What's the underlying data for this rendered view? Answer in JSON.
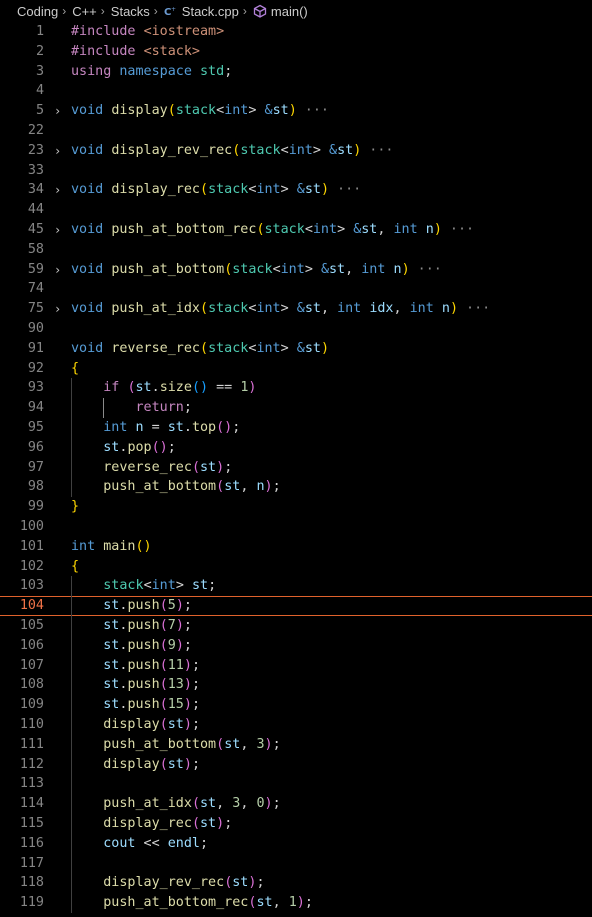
{
  "breadcrumb": {
    "items": [
      "Coding",
      "C++",
      "Stacks",
      "Stack.cpp",
      "main()"
    ]
  },
  "editor": {
    "current_line": "104",
    "lines": [
      {
        "n": "1",
        "fold": false,
        "tokens": [
          [
            "pp",
            "#include "
          ],
          [
            "str",
            "<iostream>"
          ]
        ]
      },
      {
        "n": "2",
        "fold": false,
        "tokens": [
          [
            "pp",
            "#include "
          ],
          [
            "str",
            "<stack>"
          ]
        ]
      },
      {
        "n": "3",
        "fold": false,
        "tokens": [
          [
            "ctl",
            "using "
          ],
          [
            "kw",
            "namespace "
          ],
          [
            "ty",
            "std"
          ],
          [
            "op",
            ";"
          ]
        ]
      },
      {
        "n": "4",
        "fold": false,
        "tokens": []
      },
      {
        "n": "5",
        "fold": true,
        "tokens": [
          [
            "kw",
            "void "
          ],
          [
            "fn",
            "display"
          ],
          [
            "b1",
            "("
          ],
          [
            "ty",
            "stack"
          ],
          [
            "op",
            "<"
          ],
          [
            "kw",
            "int"
          ],
          [
            "op",
            "> "
          ],
          [
            "kw",
            "&"
          ],
          [
            "var",
            "st"
          ],
          [
            "b1",
            ")"
          ],
          [
            "ell",
            " ···"
          ]
        ]
      },
      {
        "n": "22",
        "fold": false,
        "tokens": []
      },
      {
        "n": "23",
        "fold": true,
        "tokens": [
          [
            "kw",
            "void "
          ],
          [
            "fn",
            "display_rev_rec"
          ],
          [
            "b1",
            "("
          ],
          [
            "ty",
            "stack"
          ],
          [
            "op",
            "<"
          ],
          [
            "kw",
            "int"
          ],
          [
            "op",
            "> "
          ],
          [
            "kw",
            "&"
          ],
          [
            "var",
            "st"
          ],
          [
            "b1",
            ")"
          ],
          [
            "ell",
            " ···"
          ]
        ]
      },
      {
        "n": "33",
        "fold": false,
        "tokens": []
      },
      {
        "n": "34",
        "fold": true,
        "tokens": [
          [
            "kw",
            "void "
          ],
          [
            "fn",
            "display_rec"
          ],
          [
            "b1",
            "("
          ],
          [
            "ty",
            "stack"
          ],
          [
            "op",
            "<"
          ],
          [
            "kw",
            "int"
          ],
          [
            "op",
            "> "
          ],
          [
            "kw",
            "&"
          ],
          [
            "var",
            "st"
          ],
          [
            "b1",
            ")"
          ],
          [
            "ell",
            " ···"
          ]
        ]
      },
      {
        "n": "44",
        "fold": false,
        "tokens": []
      },
      {
        "n": "45",
        "fold": true,
        "tokens": [
          [
            "kw",
            "void "
          ],
          [
            "fn",
            "push_at_bottom_rec"
          ],
          [
            "b1",
            "("
          ],
          [
            "ty",
            "stack"
          ],
          [
            "op",
            "<"
          ],
          [
            "kw",
            "int"
          ],
          [
            "op",
            "> "
          ],
          [
            "kw",
            "&"
          ],
          [
            "var",
            "st"
          ],
          [
            "op",
            ", "
          ],
          [
            "kw",
            "int "
          ],
          [
            "var",
            "n"
          ],
          [
            "b1",
            ")"
          ],
          [
            "ell",
            " ···"
          ]
        ]
      },
      {
        "n": "58",
        "fold": false,
        "tokens": []
      },
      {
        "n": "59",
        "fold": true,
        "tokens": [
          [
            "kw",
            "void "
          ],
          [
            "fn",
            "push_at_bottom"
          ],
          [
            "b1",
            "("
          ],
          [
            "ty",
            "stack"
          ],
          [
            "op",
            "<"
          ],
          [
            "kw",
            "int"
          ],
          [
            "op",
            "> "
          ],
          [
            "kw",
            "&"
          ],
          [
            "var",
            "st"
          ],
          [
            "op",
            ", "
          ],
          [
            "kw",
            "int "
          ],
          [
            "var",
            "n"
          ],
          [
            "b1",
            ")"
          ],
          [
            "ell",
            " ···"
          ]
        ]
      },
      {
        "n": "74",
        "fold": false,
        "tokens": []
      },
      {
        "n": "75",
        "fold": true,
        "tokens": [
          [
            "kw",
            "void "
          ],
          [
            "fn",
            "push_at_idx"
          ],
          [
            "b1",
            "("
          ],
          [
            "ty",
            "stack"
          ],
          [
            "op",
            "<"
          ],
          [
            "kw",
            "int"
          ],
          [
            "op",
            "> "
          ],
          [
            "kw",
            "&"
          ],
          [
            "var",
            "st"
          ],
          [
            "op",
            ", "
          ],
          [
            "kw",
            "int "
          ],
          [
            "var",
            "idx"
          ],
          [
            "op",
            ", "
          ],
          [
            "kw",
            "int "
          ],
          [
            "var",
            "n"
          ],
          [
            "b1",
            ")"
          ],
          [
            "ell",
            " ···"
          ]
        ]
      },
      {
        "n": "90",
        "fold": false,
        "tokens": []
      },
      {
        "n": "91",
        "fold": false,
        "tokens": [
          [
            "kw",
            "void "
          ],
          [
            "fn",
            "reverse_rec"
          ],
          [
            "b1",
            "("
          ],
          [
            "ty",
            "stack"
          ],
          [
            "op",
            "<"
          ],
          [
            "kw",
            "int"
          ],
          [
            "op",
            "> "
          ],
          [
            "kw",
            "&"
          ],
          [
            "var",
            "st"
          ],
          [
            "b1",
            ")"
          ]
        ]
      },
      {
        "n": "92",
        "fold": false,
        "tokens": [
          [
            "b1",
            "{"
          ]
        ]
      },
      {
        "n": "93",
        "fold": false,
        "tokens": [
          [
            "op",
            "    "
          ],
          [
            "ctl",
            "if "
          ],
          [
            "b2",
            "("
          ],
          [
            "var",
            "st"
          ],
          [
            "op",
            "."
          ],
          [
            "fn",
            "size"
          ],
          [
            "b3",
            "()"
          ],
          [
            "op",
            " == "
          ],
          [
            "num",
            "1"
          ],
          [
            "b2",
            ")"
          ]
        ]
      },
      {
        "n": "94",
        "fold": false,
        "tokens": [
          [
            "op",
            "        "
          ],
          [
            "ctl",
            "return"
          ],
          [
            "op",
            ";"
          ]
        ]
      },
      {
        "n": "95",
        "fold": false,
        "tokens": [
          [
            "op",
            "    "
          ],
          [
            "kw",
            "int "
          ],
          [
            "var",
            "n"
          ],
          [
            "op",
            " = "
          ],
          [
            "var",
            "st"
          ],
          [
            "op",
            "."
          ],
          [
            "fn",
            "top"
          ],
          [
            "b2",
            "()"
          ],
          [
            "op",
            ";"
          ]
        ]
      },
      {
        "n": "96",
        "fold": false,
        "tokens": [
          [
            "op",
            "    "
          ],
          [
            "var",
            "st"
          ],
          [
            "op",
            "."
          ],
          [
            "fn",
            "pop"
          ],
          [
            "b2",
            "()"
          ],
          [
            "op",
            ";"
          ]
        ]
      },
      {
        "n": "97",
        "fold": false,
        "tokens": [
          [
            "op",
            "    "
          ],
          [
            "fn",
            "reverse_rec"
          ],
          [
            "b2",
            "("
          ],
          [
            "var",
            "st"
          ],
          [
            "b2",
            ")"
          ],
          [
            "op",
            ";"
          ]
        ]
      },
      {
        "n": "98",
        "fold": false,
        "tokens": [
          [
            "op",
            "    "
          ],
          [
            "fn",
            "push_at_bottom"
          ],
          [
            "b2",
            "("
          ],
          [
            "var",
            "st"
          ],
          [
            "op",
            ", "
          ],
          [
            "var",
            "n"
          ],
          [
            "b2",
            ")"
          ],
          [
            "op",
            ";"
          ]
        ]
      },
      {
        "n": "99",
        "fold": false,
        "tokens": [
          [
            "b1",
            "}"
          ]
        ]
      },
      {
        "n": "100",
        "fold": false,
        "tokens": []
      },
      {
        "n": "101",
        "fold": false,
        "tokens": [
          [
            "kw",
            "int "
          ],
          [
            "fn",
            "main"
          ],
          [
            "b1",
            "()"
          ]
        ]
      },
      {
        "n": "102",
        "fold": false,
        "tokens": [
          [
            "b1",
            "{"
          ]
        ]
      },
      {
        "n": "103",
        "fold": false,
        "tokens": [
          [
            "op",
            "    "
          ],
          [
            "ty",
            "stack"
          ],
          [
            "op",
            "<"
          ],
          [
            "kw",
            "int"
          ],
          [
            "op",
            "> "
          ],
          [
            "var",
            "st"
          ],
          [
            "op",
            ";"
          ]
        ]
      },
      {
        "n": "104",
        "fold": false,
        "tokens": [
          [
            "op",
            "    "
          ],
          [
            "var",
            "st"
          ],
          [
            "op",
            "."
          ],
          [
            "fn",
            "push"
          ],
          [
            "b2",
            "("
          ],
          [
            "num",
            "5"
          ],
          [
            "b2",
            ")"
          ],
          [
            "op",
            ";"
          ]
        ]
      },
      {
        "n": "105",
        "fold": false,
        "tokens": [
          [
            "op",
            "    "
          ],
          [
            "var",
            "st"
          ],
          [
            "op",
            "."
          ],
          [
            "fn",
            "push"
          ],
          [
            "b2",
            "("
          ],
          [
            "num",
            "7"
          ],
          [
            "b2",
            ")"
          ],
          [
            "op",
            ";"
          ]
        ]
      },
      {
        "n": "106",
        "fold": false,
        "tokens": [
          [
            "op",
            "    "
          ],
          [
            "var",
            "st"
          ],
          [
            "op",
            "."
          ],
          [
            "fn",
            "push"
          ],
          [
            "b2",
            "("
          ],
          [
            "num",
            "9"
          ],
          [
            "b2",
            ")"
          ],
          [
            "op",
            ";"
          ]
        ]
      },
      {
        "n": "107",
        "fold": false,
        "tokens": [
          [
            "op",
            "    "
          ],
          [
            "var",
            "st"
          ],
          [
            "op",
            "."
          ],
          [
            "fn",
            "push"
          ],
          [
            "b2",
            "("
          ],
          [
            "num",
            "11"
          ],
          [
            "b2",
            ")"
          ],
          [
            "op",
            ";"
          ]
        ]
      },
      {
        "n": "108",
        "fold": false,
        "tokens": [
          [
            "op",
            "    "
          ],
          [
            "var",
            "st"
          ],
          [
            "op",
            "."
          ],
          [
            "fn",
            "push"
          ],
          [
            "b2",
            "("
          ],
          [
            "num",
            "13"
          ],
          [
            "b2",
            ")"
          ],
          [
            "op",
            ";"
          ]
        ]
      },
      {
        "n": "109",
        "fold": false,
        "tokens": [
          [
            "op",
            "    "
          ],
          [
            "var",
            "st"
          ],
          [
            "op",
            "."
          ],
          [
            "fn",
            "push"
          ],
          [
            "b2",
            "("
          ],
          [
            "num",
            "15"
          ],
          [
            "b2",
            ")"
          ],
          [
            "op",
            ";"
          ]
        ]
      },
      {
        "n": "110",
        "fold": false,
        "tokens": [
          [
            "op",
            "    "
          ],
          [
            "fn",
            "display"
          ],
          [
            "b2",
            "("
          ],
          [
            "var",
            "st"
          ],
          [
            "b2",
            ")"
          ],
          [
            "op",
            ";"
          ]
        ]
      },
      {
        "n": "111",
        "fold": false,
        "tokens": [
          [
            "op",
            "    "
          ],
          [
            "fn",
            "push_at_bottom"
          ],
          [
            "b2",
            "("
          ],
          [
            "var",
            "st"
          ],
          [
            "op",
            ", "
          ],
          [
            "num",
            "3"
          ],
          [
            "b2",
            ")"
          ],
          [
            "op",
            ";"
          ]
        ]
      },
      {
        "n": "112",
        "fold": false,
        "tokens": [
          [
            "op",
            "    "
          ],
          [
            "fn",
            "display"
          ],
          [
            "b2",
            "("
          ],
          [
            "var",
            "st"
          ],
          [
            "b2",
            ")"
          ],
          [
            "op",
            ";"
          ]
        ]
      },
      {
        "n": "113",
        "fold": false,
        "tokens": []
      },
      {
        "n": "114",
        "fold": false,
        "tokens": [
          [
            "op",
            "    "
          ],
          [
            "fn",
            "push_at_idx"
          ],
          [
            "b2",
            "("
          ],
          [
            "var",
            "st"
          ],
          [
            "op",
            ", "
          ],
          [
            "num",
            "3"
          ],
          [
            "op",
            ", "
          ],
          [
            "num",
            "0"
          ],
          [
            "b2",
            ")"
          ],
          [
            "op",
            ";"
          ]
        ]
      },
      {
        "n": "115",
        "fold": false,
        "tokens": [
          [
            "op",
            "    "
          ],
          [
            "fn",
            "display_rec"
          ],
          [
            "b2",
            "("
          ],
          [
            "var",
            "st"
          ],
          [
            "b2",
            ")"
          ],
          [
            "op",
            ";"
          ]
        ]
      },
      {
        "n": "116",
        "fold": false,
        "tokens": [
          [
            "op",
            "    "
          ],
          [
            "var",
            "cout"
          ],
          [
            "op",
            " << "
          ],
          [
            "var",
            "endl"
          ],
          [
            "op",
            ";"
          ]
        ]
      },
      {
        "n": "117",
        "fold": false,
        "tokens": []
      },
      {
        "n": "118",
        "fold": false,
        "tokens": [
          [
            "op",
            "    "
          ],
          [
            "fn",
            "display_rev_rec"
          ],
          [
            "b2",
            "("
          ],
          [
            "var",
            "st"
          ],
          [
            "b2",
            ")"
          ],
          [
            "op",
            ";"
          ]
        ]
      },
      {
        "n": "119",
        "fold": false,
        "tokens": [
          [
            "op",
            "    "
          ],
          [
            "fn",
            "push_at_bottom_rec"
          ],
          [
            "b2",
            "("
          ],
          [
            "var",
            "st"
          ],
          [
            "op",
            ", "
          ],
          [
            "num",
            "1"
          ],
          [
            "b2",
            ")"
          ],
          [
            "op",
            ";"
          ]
        ]
      }
    ]
  }
}
